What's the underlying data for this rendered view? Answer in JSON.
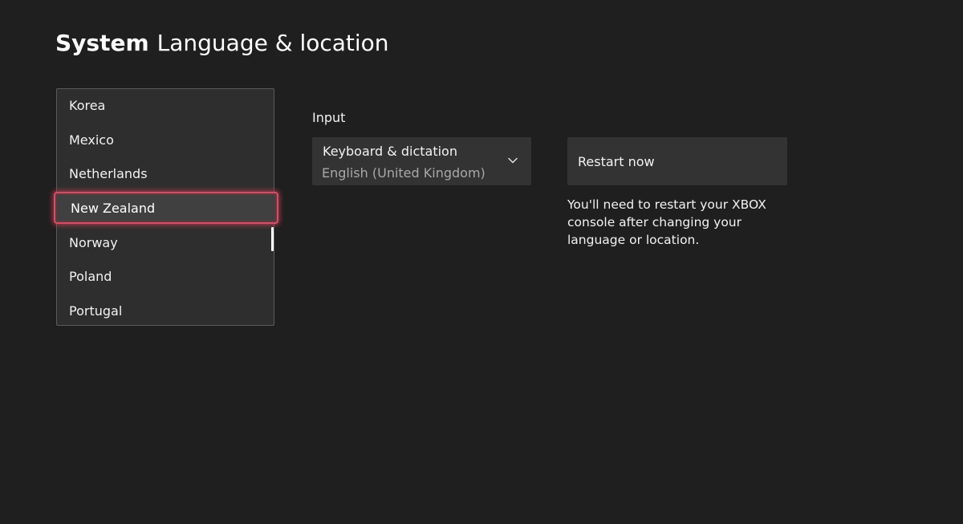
{
  "header": {
    "app_name": "System",
    "page_title": "Language & location"
  },
  "country_list": {
    "items": [
      {
        "label": "Korea"
      },
      {
        "label": "Mexico"
      },
      {
        "label": "Netherlands"
      },
      {
        "label": "New Zealand",
        "selected": true
      },
      {
        "label": "Norway"
      },
      {
        "label": "Poland"
      },
      {
        "label": "Portugal"
      }
    ]
  },
  "input": {
    "section_label": "Input",
    "dropdown_title": "Keyboard & dictation",
    "dropdown_value": "English (United Kingdom)"
  },
  "restart": {
    "button_label": "Restart now",
    "note": "You'll need to restart your XBOX console after changing your language or location."
  },
  "colors": {
    "background": "#1f1f1f",
    "focus_accent": "#e64560"
  }
}
